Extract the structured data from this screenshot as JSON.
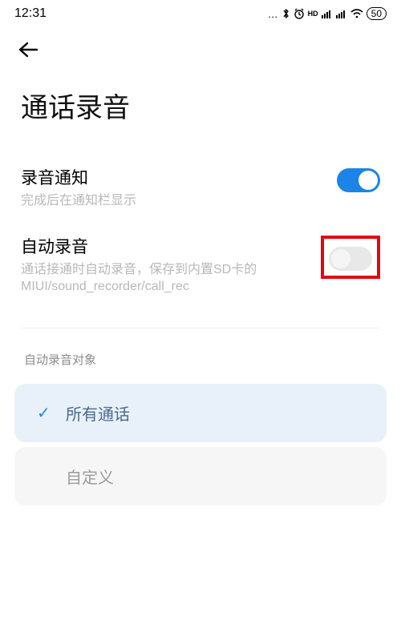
{
  "status_bar": {
    "time": "12:31",
    "hd_label": "HD",
    "battery": "50"
  },
  "header": {
    "title": "通话录音"
  },
  "settings": {
    "recording_notification": {
      "title": "录音通知",
      "desc": "完成后在通知栏显示",
      "enabled": true
    },
    "auto_recording": {
      "title": "自动录音",
      "desc": "通话接通时自动录音，保存到内置SD卡的MIUI/sound_recorder/call_rec",
      "enabled": false
    }
  },
  "auto_target": {
    "header": "自动录音对象",
    "options": [
      {
        "label": "所有通话",
        "selected": true
      },
      {
        "label": "自定义",
        "selected": false
      }
    ]
  }
}
